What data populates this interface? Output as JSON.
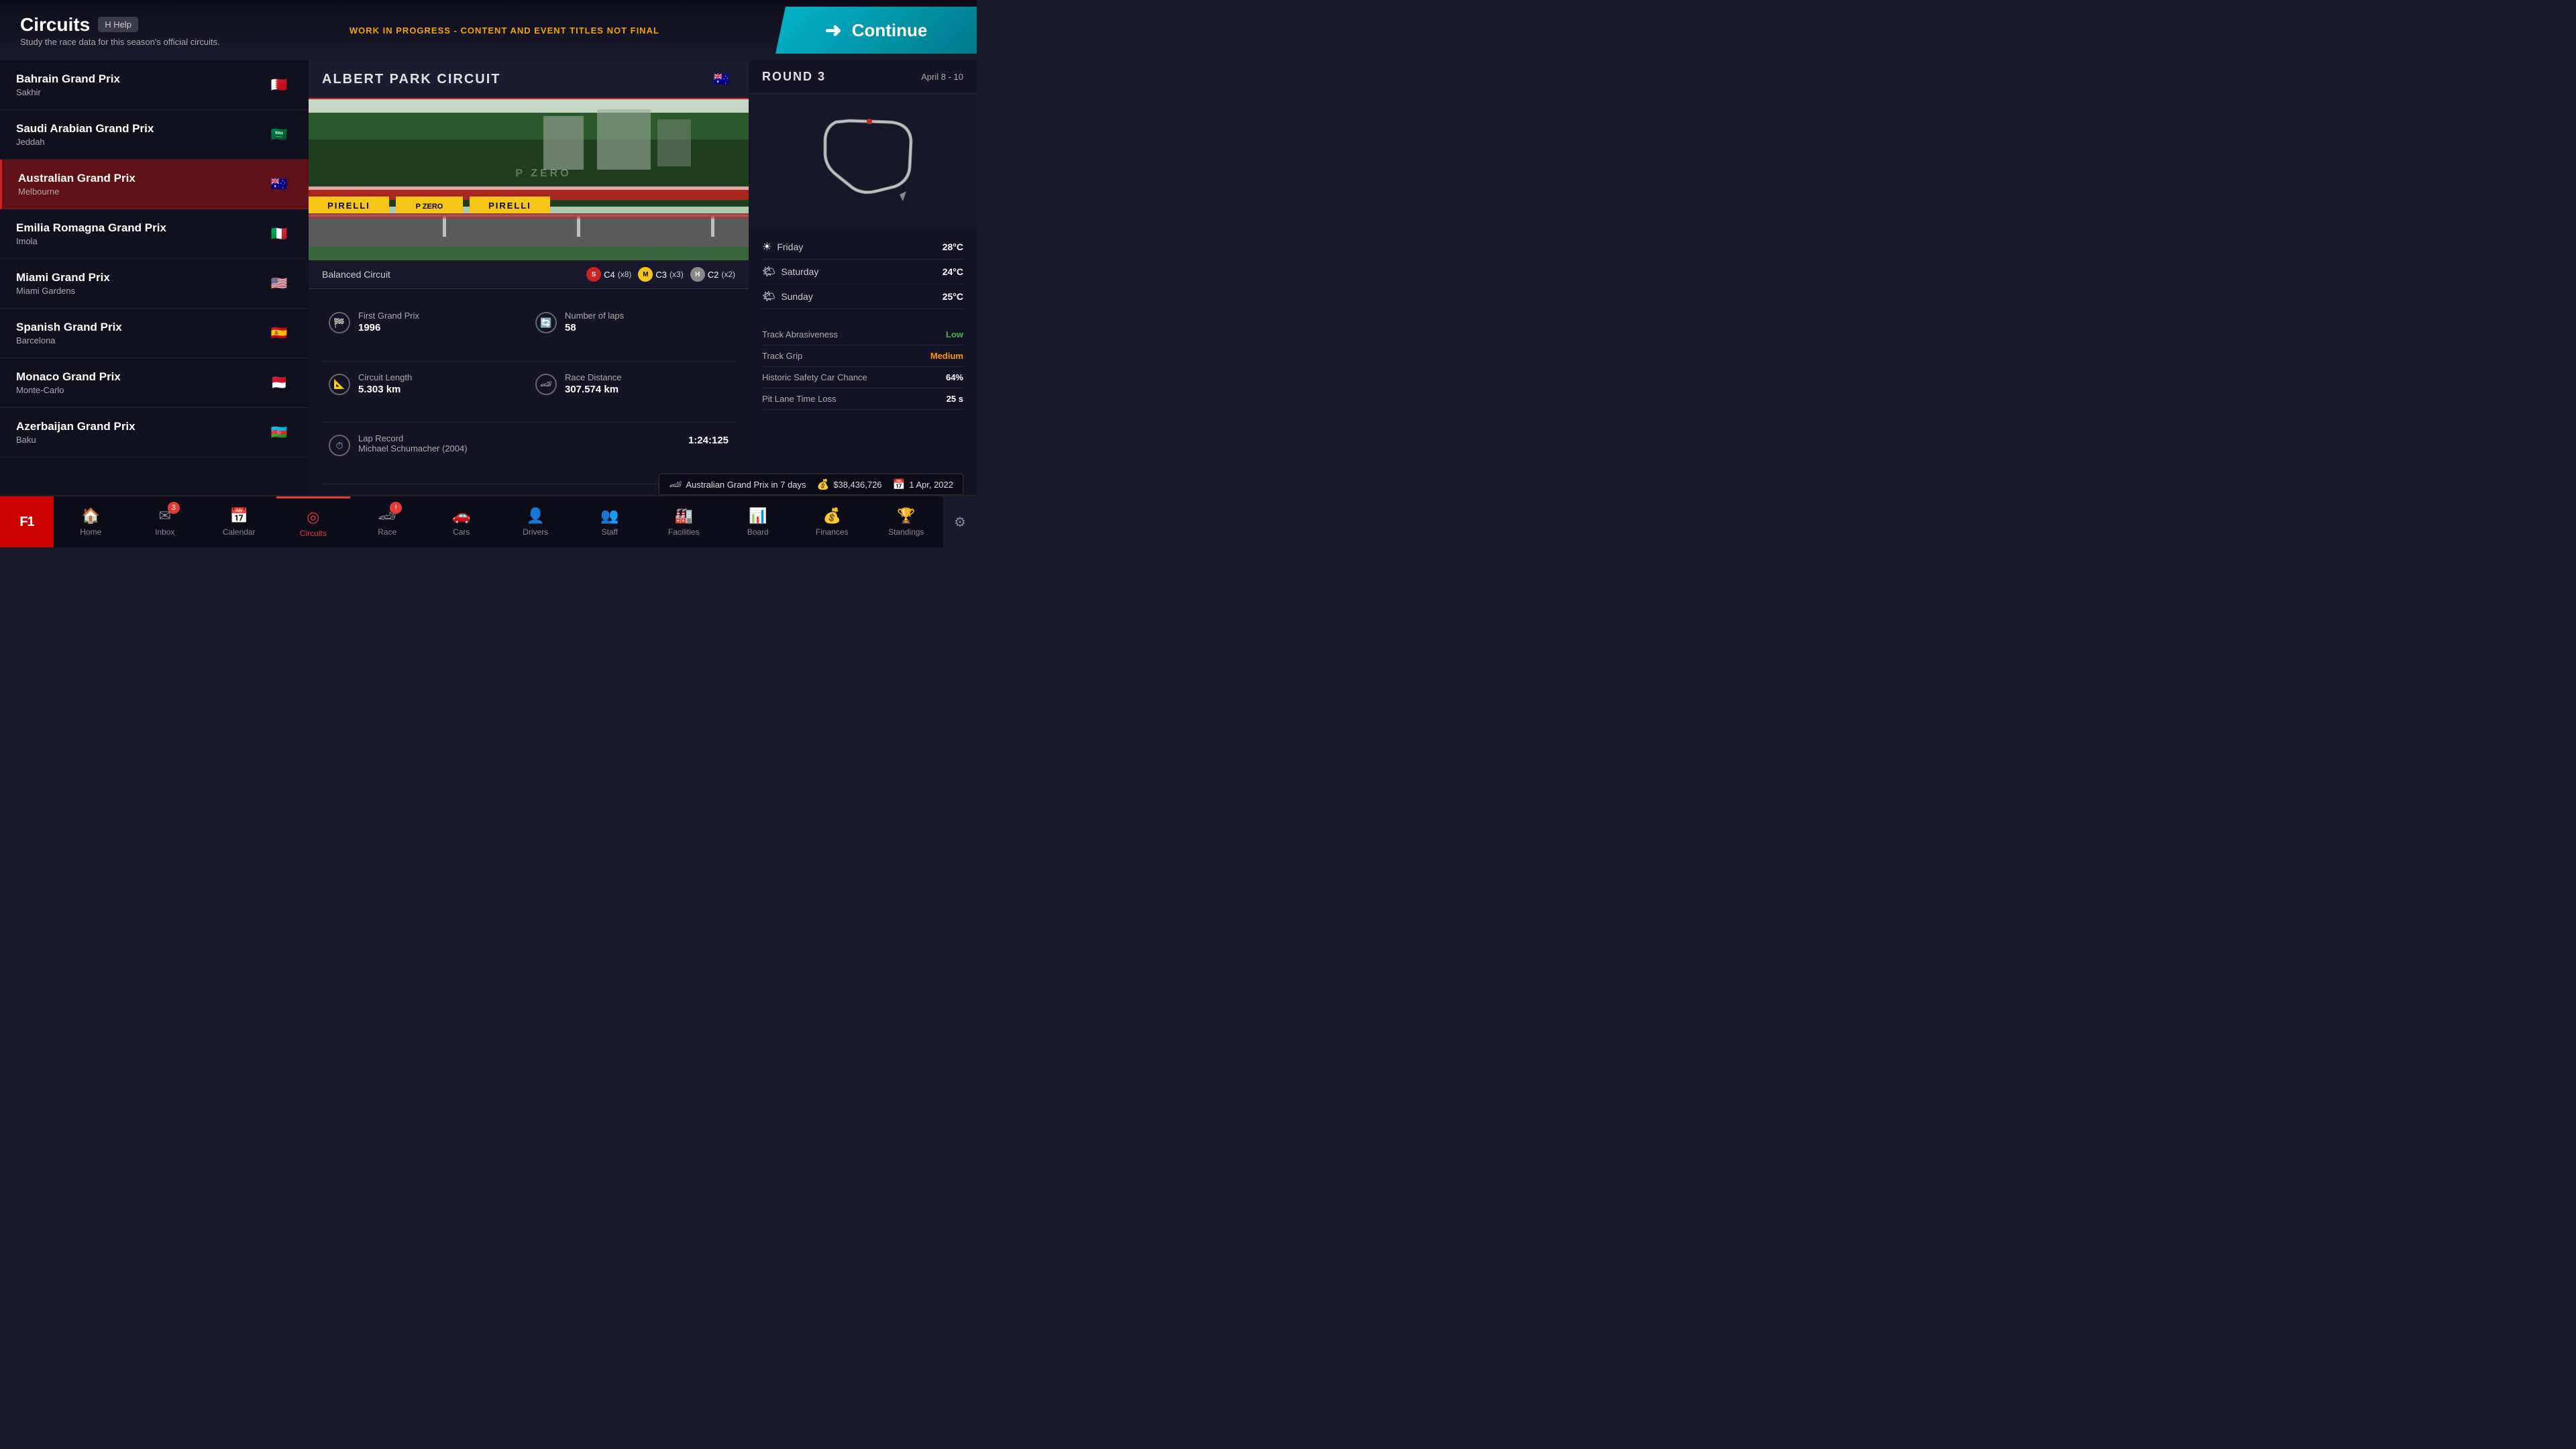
{
  "header": {
    "title": "Circuits",
    "help_label": "H  Help",
    "subtitle": "Study the race data for this season's official circuits.",
    "wip_notice": "WORK IN PROGRESS - CONTENT AND EVENT TITLES NOT FINAL",
    "continue_label": "Continue"
  },
  "circuits": [
    {
      "id": "bahrain",
      "name": "Bahrain Grand Prix",
      "city": "Sakhir",
      "flag": "🇧🇭",
      "flagClass": "flag-bahrain",
      "active": false
    },
    {
      "id": "saudi",
      "name": "Saudi Arabian Grand Prix",
      "city": "Jeddah",
      "flag": "🇸🇦",
      "flagClass": "flag-saudi",
      "active": false
    },
    {
      "id": "australia",
      "name": "Australian Grand Prix",
      "city": "Melbourne",
      "flag": "🇦🇺",
      "flagClass": "flag-australia",
      "active": true
    },
    {
      "id": "emilia",
      "name": "Emilia Romagna Grand Prix",
      "city": "Imola",
      "flag": "🇮🇹",
      "flagClass": "flag-italy",
      "active": false
    },
    {
      "id": "miami",
      "name": "Miami Grand Prix",
      "city": "Miami Gardens",
      "flag": "🇺🇸",
      "flagClass": "flag-usa",
      "active": false
    },
    {
      "id": "spain",
      "name": "Spanish Grand Prix",
      "city": "Barcelona",
      "flag": "🇪🇸",
      "flagClass": "flag-spain",
      "active": false
    },
    {
      "id": "monaco",
      "name": "Monaco Grand Prix",
      "city": "Monte-Carlo",
      "flag": "🇲🇨",
      "flagClass": "flag-monaco",
      "active": false
    },
    {
      "id": "azerbaijan",
      "name": "Azerbaijan Grand Prix",
      "city": "Baku",
      "flag": "🇦🇿",
      "flagClass": "flag-azerbaijan",
      "active": false
    }
  ],
  "selected_circuit": {
    "name": "ALBERT PARK CIRCUIT",
    "flag": "🇦🇺",
    "round": "ROUND 3",
    "dates": "April 8 - 10",
    "circuit_type": "Balanced Circuit",
    "tyres": [
      {
        "type": "S",
        "compound": "C4",
        "count": "x8",
        "class": "soft"
      },
      {
        "type": "M",
        "compound": "C3",
        "count": "x3",
        "class": "medium"
      },
      {
        "type": "H",
        "compound": "C2",
        "count": "x2",
        "class": "hard"
      }
    ],
    "stats": [
      {
        "icon": "🏁",
        "label": "First Grand Prix",
        "value": "1996",
        "col": 1
      },
      {
        "icon": "🔄",
        "label": "Number of laps",
        "value": "58",
        "col": 2
      },
      {
        "icon": "📐",
        "label": "Circuit Length",
        "value": "5.303 km",
        "col": 1
      },
      {
        "icon": "🏎",
        "label": "Race Distance",
        "value": "307.574 km",
        "col": 2
      },
      {
        "icon": "⏱",
        "label": "Lap Record",
        "sub": "Michael Schumacher (2004)",
        "value": "1:24:125",
        "full": true
      }
    ]
  },
  "weather": [
    {
      "day": "Friday",
      "icon": "☀",
      "temp": "28°C"
    },
    {
      "day": "Saturday",
      "icon": "🌤",
      "temp": "24°C"
    },
    {
      "day": "Sunday",
      "icon": "🌤",
      "temp": "25°C"
    }
  ],
  "track_stats": [
    {
      "label": "Track Abrasiveness",
      "value": "Low",
      "class": "low"
    },
    {
      "label": "Track Grip",
      "value": "Medium",
      "class": "medium"
    },
    {
      "label": "Historic Safety Car Chance",
      "value": "64%",
      "class": ""
    },
    {
      "label": "Pit Lane Time Loss",
      "value": "25 s",
      "class": ""
    }
  ],
  "bottom_status": {
    "race": "Australian Grand Prix in 7 days",
    "money": "$38,436,726",
    "date": "1 Apr, 2022"
  },
  "nav_items": [
    {
      "id": "home",
      "label": "Home",
      "icon": "🏠",
      "active": false,
      "badge": null
    },
    {
      "id": "inbox",
      "label": "Inbox",
      "icon": "✉",
      "active": false,
      "badge": "3"
    },
    {
      "id": "calendar",
      "label": "Calendar",
      "icon": "📅",
      "active": false,
      "badge": null
    },
    {
      "id": "circuits",
      "label": "Circuits",
      "icon": "◎",
      "active": true,
      "badge": null
    },
    {
      "id": "race",
      "label": "Race",
      "icon": "🏎",
      "active": false,
      "badge": "!"
    },
    {
      "id": "cars",
      "label": "Cars",
      "icon": "🚗",
      "active": false,
      "badge": null
    },
    {
      "id": "drivers",
      "label": "Drivers",
      "icon": "👤",
      "active": false,
      "badge": null
    },
    {
      "id": "staff",
      "label": "Staff",
      "icon": "👥",
      "active": false,
      "badge": null
    },
    {
      "id": "facilities",
      "label": "Facilities",
      "icon": "🏭",
      "active": false,
      "badge": null
    },
    {
      "id": "board",
      "label": "Board",
      "icon": "📊",
      "active": false,
      "badge": null
    },
    {
      "id": "finances",
      "label": "Finances",
      "icon": "💰",
      "active": false,
      "badge": null
    },
    {
      "id": "standings",
      "label": "Standings",
      "icon": "🏆",
      "active": false,
      "badge": null
    }
  ]
}
